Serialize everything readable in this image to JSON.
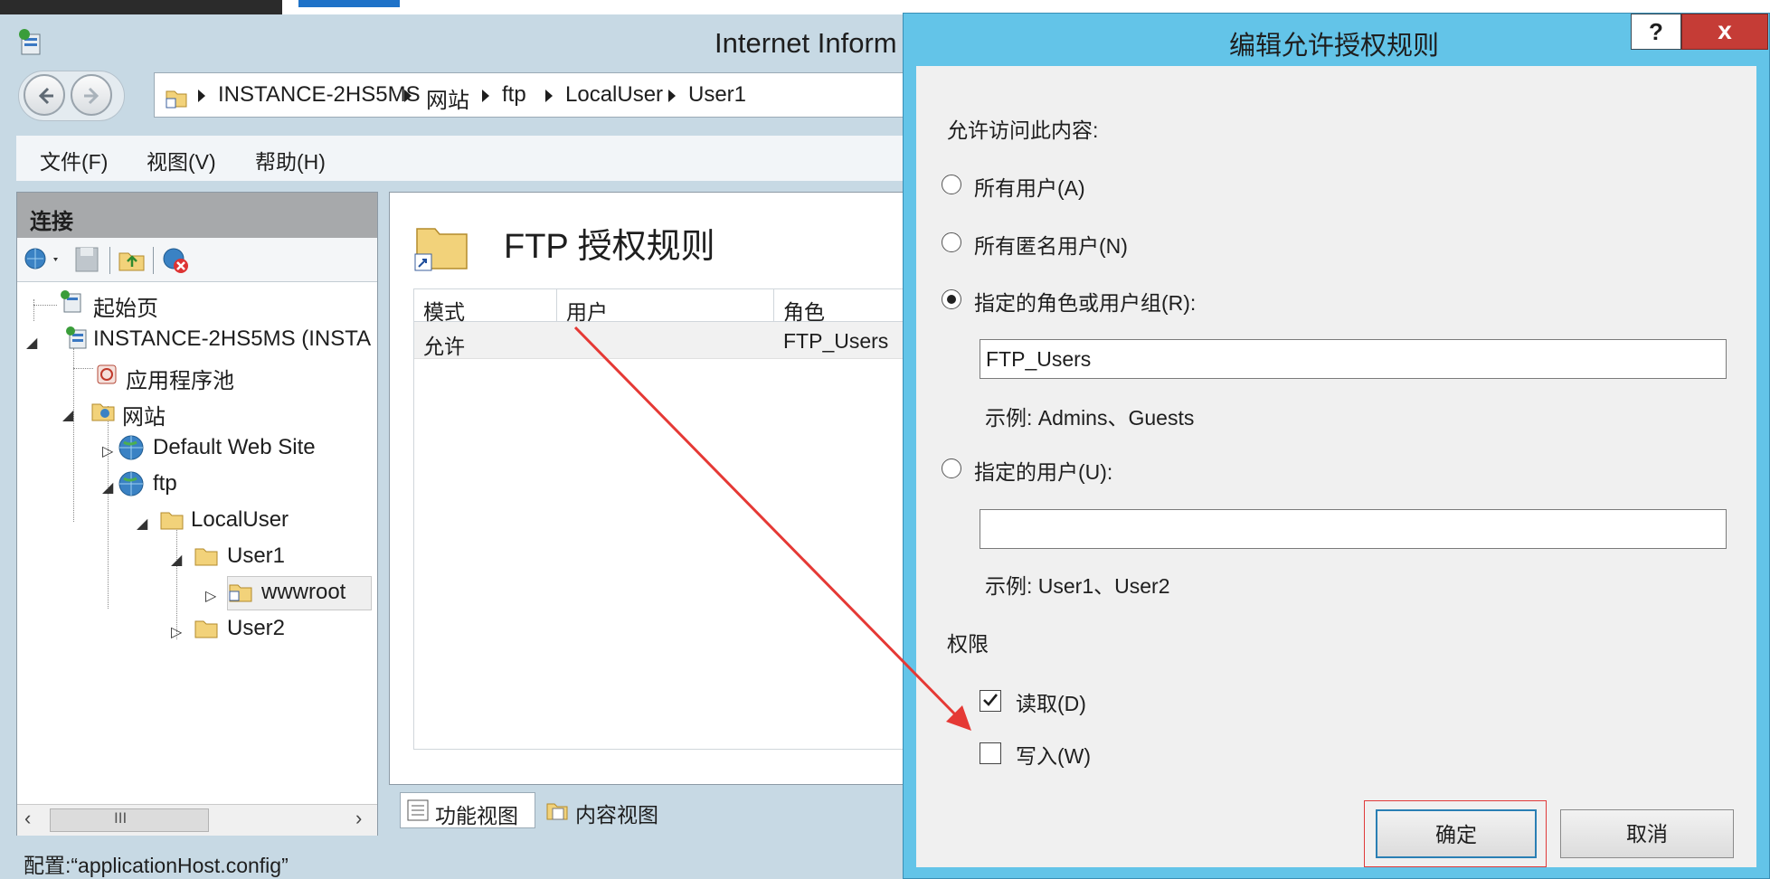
{
  "window": {
    "title": "Internet Inform"
  },
  "address": {
    "crumbs": [
      "INSTANCE-2HS5MS",
      "网站",
      "ftp",
      "LocalUser",
      "User1"
    ]
  },
  "menu": [
    "文件(F)",
    "视图(V)",
    "帮助(H)"
  ],
  "connections": {
    "title": "连接",
    "tree": [
      {
        "label": "起始页"
      },
      {
        "label": "INSTANCE-2HS5MS (INSTA"
      },
      {
        "label": "应用程序池"
      },
      {
        "label": "网站"
      },
      {
        "label": "Default Web Site"
      },
      {
        "label": "ftp"
      },
      {
        "label": "LocalUser"
      },
      {
        "label": "User1"
      },
      {
        "label": "wwwroot"
      },
      {
        "label": "User2"
      }
    ],
    "scroll_grip": "III"
  },
  "feature": {
    "title": "FTP 授权规则",
    "columns": [
      "模式",
      "用户",
      "角色"
    ],
    "rows": [
      {
        "mode": "允许",
        "user": "",
        "role": "FTP_Users"
      }
    ],
    "views": [
      "功能视图",
      "内容视图"
    ]
  },
  "status": {
    "text": "配置:“applicationHost.config”"
  },
  "dialog": {
    "title": "编辑允许授权规则",
    "help": "?",
    "close": "x",
    "prompt": "允许访问此内容:",
    "options": {
      "all_users": "所有用户(A)",
      "anonymous": "所有匿名用户(N)",
      "roles": "指定的角色或用户组(R):",
      "users": "指定的用户(U):"
    },
    "selected_option": "roles",
    "roles_value": "FTP_Users",
    "roles_example": "示例: Admins、Guests",
    "users_value": "",
    "users_example": "示例: User1、User2",
    "permissions_label": "权限",
    "read_label": "读取(D)",
    "read_checked": true,
    "write_label": "写入(W)",
    "write_checked": false,
    "ok": "确定",
    "cancel": "取消"
  },
  "colors": {
    "dialog_frame": "#63c4e8",
    "close_button": "#c53c36",
    "annotation": "#e53935",
    "window_frame": "#c7d9e4"
  }
}
